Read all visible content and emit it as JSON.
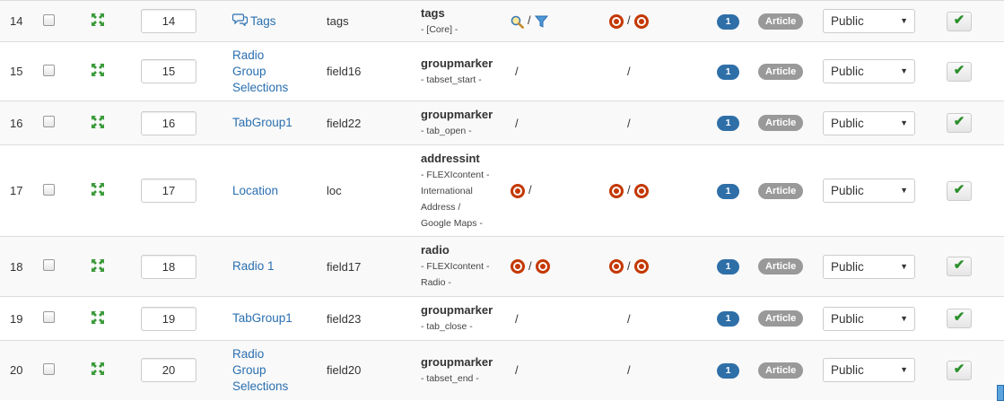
{
  "rows": [
    {
      "num": "14",
      "order": "14",
      "label": "Tags",
      "label_icon": "comment-icon",
      "name": "tags",
      "type_main": "tags",
      "type_sub": [
        "- [Core] -"
      ],
      "search": "search-icon",
      "filter": "filter-icon",
      "search_mode": "icons",
      "filter_mode": "rings",
      "access": "1",
      "assign": "Article",
      "public": "Public",
      "id": "14"
    },
    {
      "num": "15",
      "order": "15",
      "label": "Radio Group Selections",
      "name": "field16",
      "type_main": "groupmarker",
      "type_sub": [
        "- tabset_start -"
      ],
      "search_mode": "slash",
      "filter_mode": "slash",
      "access": "1",
      "assign": "Article",
      "public": "Public",
      "id": "16"
    },
    {
      "num": "16",
      "order": "16",
      "label": "TabGroup1",
      "name": "field22",
      "type_main": "groupmarker",
      "type_sub": [
        "- tab_open -"
      ],
      "search_mode": "slash",
      "filter_mode": "slash",
      "access": "1",
      "assign": "Article",
      "public": "Public",
      "id": "22"
    },
    {
      "num": "17",
      "order": "17",
      "label": "Location",
      "name": "loc",
      "type_main": "addressint",
      "type_sub": [
        "- FLEXIcontent -",
        "International",
        "Address /",
        "Google Maps -"
      ],
      "search_mode": "ring-slash",
      "filter_mode": "rings",
      "access": "1",
      "assign": "Article",
      "public": "Public",
      "id": "15"
    },
    {
      "num": "18",
      "order": "18",
      "label": "Radio 1",
      "name": "field17",
      "type_main": "radio",
      "type_sub": [
        "- FLEXIcontent -",
        "Radio -"
      ],
      "search_mode": "rings",
      "filter_mode": "rings",
      "access": "1",
      "assign": "Article",
      "public": "Public",
      "id": "17"
    },
    {
      "num": "19",
      "order": "19",
      "label": "TabGroup1",
      "name": "field23",
      "type_main": "groupmarker",
      "type_sub": [
        "- tab_close -"
      ],
      "search_mode": "slash",
      "filter_mode": "slash",
      "access": "1",
      "assign": "Article",
      "public": "Public",
      "id": "23"
    },
    {
      "num": "20",
      "order": "20",
      "label": "Radio Group Selections",
      "name": "field20",
      "type_main": "groupmarker",
      "type_sub": [
        "- tabset_end -"
      ],
      "search_mode": "slash",
      "filter_mode": "slash",
      "access": "1",
      "assign": "Article",
      "public": "Public",
      "id": "21"
    }
  ],
  "colors": {
    "link": "#2a6fb0",
    "ring": "#c43800",
    "badge": "#2f6fa8",
    "check": "#2b8f2b"
  }
}
